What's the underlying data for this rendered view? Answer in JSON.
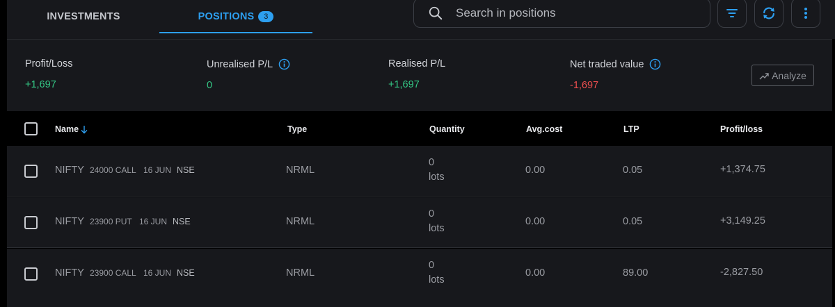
{
  "tabs": [
    {
      "label": "INVESTMENTS",
      "active": false
    },
    {
      "label": "POSITIONS",
      "active": true,
      "badge": "3"
    }
  ],
  "search": {
    "placeholder": "Search in positions"
  },
  "toolbar_icons": [
    "filter-icon",
    "refresh-icon",
    "more-vertical-icon"
  ],
  "summary": {
    "profit_loss": {
      "label": "Profit/Loss",
      "value": "+1,697"
    },
    "unrealised": {
      "label": "Unrealised P/L",
      "value": "0"
    },
    "realised": {
      "label": "Realised P/L",
      "value": "+1,697"
    },
    "net_traded": {
      "label": "Net traded value",
      "value": "-1,697"
    },
    "analyze_label": "Analyze"
  },
  "table": {
    "columns": {
      "name": "Name",
      "type": "Type",
      "quantity": "Quantity",
      "avg_cost": "Avg.cost",
      "ltp": "LTP",
      "pnl": "Profit/loss"
    },
    "rows": [
      {
        "symbol": "NIFTY",
        "strike": "24000 CALL",
        "expiry": "16 JUN",
        "exchange": "NSE",
        "type": "NRML",
        "qty": "0",
        "qty_unit": "lots",
        "avg_cost": "0.00",
        "ltp": "0.05",
        "pnl": "+1,374.75"
      },
      {
        "symbol": "NIFTY",
        "strike": "23900 PUT",
        "expiry": "16 JUN",
        "exchange": "NSE",
        "type": "NRML",
        "qty": "0",
        "qty_unit": "lots",
        "avg_cost": "0.00",
        "ltp": "0.05",
        "pnl": "+3,149.25"
      },
      {
        "symbol": "NIFTY",
        "strike": "23900 CALL",
        "expiry": "16 JUN",
        "exchange": "NSE",
        "type": "NRML",
        "qty": "0",
        "qty_unit": "lots",
        "avg_cost": "0.00",
        "ltp": "89.00",
        "pnl": "-2,827.50"
      }
    ]
  },
  "colors": {
    "accent": "#2d9ff0",
    "positive": "#34c785",
    "negative": "#f04f4f",
    "panel": "#17181c",
    "background": "#000000"
  }
}
